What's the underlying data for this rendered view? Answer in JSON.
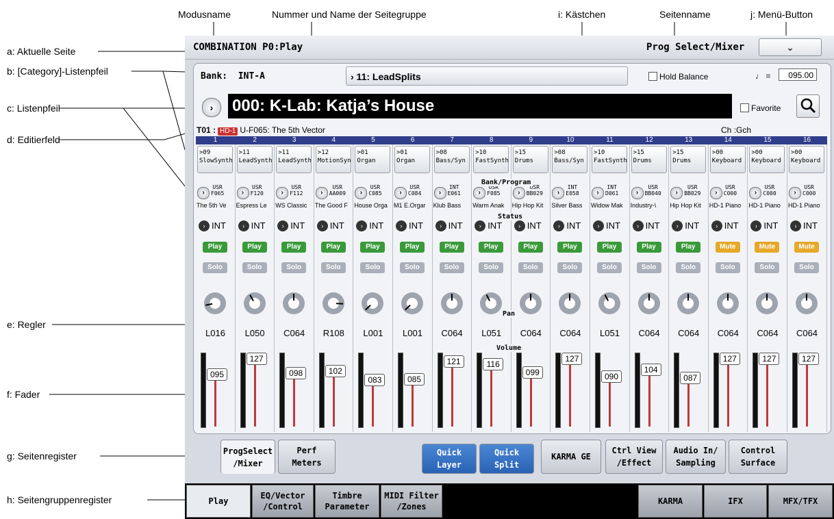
{
  "annotations": {
    "modusname": "Modusname",
    "seitengruppe": "Nummer und Name der Seitegruppe",
    "kaestchen": "i: Kästchen",
    "seitenname": "Seitenname",
    "menu": "j: Menü-Button",
    "a": "a: Aktuelle Seite",
    "b": "b: [Category]-Listenpfeil",
    "c": "c: Listenpfeil",
    "d": "d: Editierfeld",
    "e": "e: Regler",
    "f": "f: Fader",
    "g": "g: Seitenregister",
    "h": "h: Seitengruppenregister"
  },
  "header": {
    "mode": "COMBINATION P0:Play",
    "page_name": "Prog Select/Mixer",
    "menu_icon": "chevron-down-icon",
    "menu_glyph": "⌄"
  },
  "bank": {
    "label": "Bank:",
    "value": "INT-A",
    "category": "› 11: LeadSplits",
    "hold_balance": "Hold Balance",
    "tempo_symbol": "♩ =",
    "tempo": "095.00"
  },
  "program": {
    "arrow": "›",
    "name": "000: K-Lab: Katja’s House",
    "favorite": "Favorite"
  },
  "timbre_info": {
    "id": "T01 :",
    "badge": "HD-1",
    "program": "U-F065: The 5th Vector",
    "channel": "Ch :Gch"
  },
  "sections": {
    "bank_program": "Bank/Program",
    "status": "Status",
    "pan": "Pan",
    "volume": "Volume"
  },
  "colors": {
    "play": "#3a9a3a",
    "mute": "#e6a82a",
    "solo": "#aab0ba",
    "track_header": "#2f3d8a",
    "pan_red": "#b22222"
  },
  "tracks": [
    {
      "num": "1",
      "cat_num": ">09",
      "cat": "SlowSynth",
      "bank": "USR",
      "prog": "F065",
      "pname": "The 5th Ve",
      "status": "INT",
      "mode": "Play",
      "solo": "Solo",
      "pan": "L016",
      "pan_value": 16,
      "volume": "095",
      "vol_value": 95
    },
    {
      "num": "2",
      "cat_num": ">11",
      "cat": "LeadSynth",
      "bank": "USR",
      "prog": "F120",
      "pname": "Espress Le",
      "status": "INT",
      "mode": "Play",
      "solo": "Solo",
      "pan": "L050",
      "pan_value": 50,
      "volume": "127",
      "vol_value": 127
    },
    {
      "num": "3",
      "cat_num": ">11",
      "cat": "LeadSynth",
      "bank": "USR",
      "prog": "F112",
      "pname": "WS Classic",
      "status": "INT",
      "mode": "Play",
      "solo": "Solo",
      "pan": "C064",
      "pan_value": 64,
      "volume": "098",
      "vol_value": 98
    },
    {
      "num": "4",
      "cat_num": ">12",
      "cat": "MotionSyn",
      "bank": "USR",
      "prog": "AA009",
      "pname": "The Good F",
      "status": "INT",
      "mode": "Play",
      "solo": "Solo",
      "pan": "R108",
      "pan_value": 108,
      "volume": "102",
      "vol_value": 102
    },
    {
      "num": "5",
      "cat_num": ">01",
      "cat": "Organ",
      "bank": "USR",
      "prog": "C085",
      "pname": "House Orga",
      "status": "INT",
      "mode": "Play",
      "solo": "Solo",
      "pan": "L001",
      "pan_value": 1,
      "volume": "083",
      "vol_value": 83
    },
    {
      "num": "6",
      "cat_num": ">01",
      "cat": "Organ",
      "bank": "USR",
      "prog": "C084",
      "pname": "M1 E.Orgar",
      "status": "INT",
      "mode": "Play",
      "solo": "Solo",
      "pan": "L001",
      "pan_value": 1,
      "volume": "085",
      "vol_value": 85
    },
    {
      "num": "7",
      "cat_num": ">08",
      "cat": "Bass/Syn",
      "bank": "INT",
      "prog": "E061",
      "pname": "Klub Bass",
      "status": "INT",
      "mode": "Play",
      "solo": "Solo",
      "pan": "C064",
      "pan_value": 64,
      "volume": "121",
      "vol_value": 121
    },
    {
      "num": "8",
      "cat_num": ">10",
      "cat": "FastSynth",
      "bank": "USR",
      "prog": "F085",
      "pname": "Warm Anak",
      "status": "INT",
      "mode": "Play",
      "solo": "Solo",
      "pan": "L051",
      "pan_value": 51,
      "volume": "116",
      "vol_value": 116
    },
    {
      "num": "9",
      "cat_num": ">15",
      "cat": "Drums",
      "bank": "USR",
      "prog": "BB029",
      "pname": "Hip Hop Kit",
      "status": "INT",
      "mode": "Play",
      "solo": "Solo",
      "pan": "C064",
      "pan_value": 64,
      "volume": "099",
      "vol_value": 99
    },
    {
      "num": "10",
      "cat_num": ">08",
      "cat": "Bass/Syn",
      "bank": "INT",
      "prog": "E058",
      "pname": "Silver Bass",
      "status": "INT",
      "mode": "Play",
      "solo": "Solo",
      "pan": "C064",
      "pan_value": 64,
      "volume": "127",
      "vol_value": 127
    },
    {
      "num": "11",
      "cat_num": ">10",
      "cat": "FastSynth",
      "bank": "INT",
      "prog": "D061",
      "pname": "Widow Mak",
      "status": "INT",
      "mode": "Play",
      "solo": "Solo",
      "pan": "L051",
      "pan_value": 51,
      "volume": "090",
      "vol_value": 90
    },
    {
      "num": "12",
      "cat_num": ">15",
      "cat": "Drums",
      "bank": "USR",
      "prog": "BB040",
      "pname": "Industry-\\",
      "status": "INT",
      "mode": "Play",
      "solo": "Solo",
      "pan": "C064",
      "pan_value": 64,
      "volume": "104",
      "vol_value": 104
    },
    {
      "num": "13",
      "cat_num": ">15",
      "cat": "Drums",
      "bank": "USR",
      "prog": "BB029",
      "pname": "Hip Hop Kit",
      "status": "INT",
      "mode": "Play",
      "solo": "Solo",
      "pan": "C064",
      "pan_value": 64,
      "volume": "087",
      "vol_value": 87
    },
    {
      "num": "14",
      "cat_num": ">00",
      "cat": "Keyboard",
      "bank": "USR",
      "prog": "C000",
      "pname": "HD-1 Piano",
      "status": "INT",
      "mode": "Mute",
      "solo": "Solo",
      "pan": "C064",
      "pan_value": 64,
      "volume": "127",
      "vol_value": 127
    },
    {
      "num": "15",
      "cat_num": ">00",
      "cat": "Keyboard",
      "bank": "USR",
      "prog": "C000",
      "pname": "HD-1 Piano",
      "status": "INT",
      "mode": "Mute",
      "solo": "Solo",
      "pan": "C064",
      "pan_value": 64,
      "volume": "127",
      "vol_value": 127
    },
    {
      "num": "16",
      "cat_num": ">00",
      "cat": "Keyboard",
      "bank": "USR",
      "prog": "C000",
      "pname": "HD-1 Piano",
      "status": "INT",
      "mode": "Mute",
      "solo": "Solo",
      "pan": "C064",
      "pan_value": 64,
      "volume": "127",
      "vol_value": 127
    }
  ],
  "page_tabs": [
    {
      "label": "ProgSelect\n/Mixer",
      "active": true
    },
    {
      "label": "Perf\nMeters"
    },
    {
      "label": "Quick\nLayer",
      "blue": true
    },
    {
      "label": "Quick\nSplit",
      "blue": true
    },
    {
      "label": "KARMA GE"
    },
    {
      "label": "Ctrl View\n/Effect"
    },
    {
      "label": "Audio In/\nSampling"
    },
    {
      "label": "Control\nSurface"
    }
  ],
  "group_tabs": [
    {
      "label": "Play",
      "active": true
    },
    {
      "label": "EQ/Vector\n/Control"
    },
    {
      "label": "Timbre\nParameter"
    },
    {
      "label": "MIDI Filter\n/Zones"
    },
    {
      "label": "KARMA"
    },
    {
      "label": "IFX"
    },
    {
      "label": "MFX/TFX"
    }
  ]
}
